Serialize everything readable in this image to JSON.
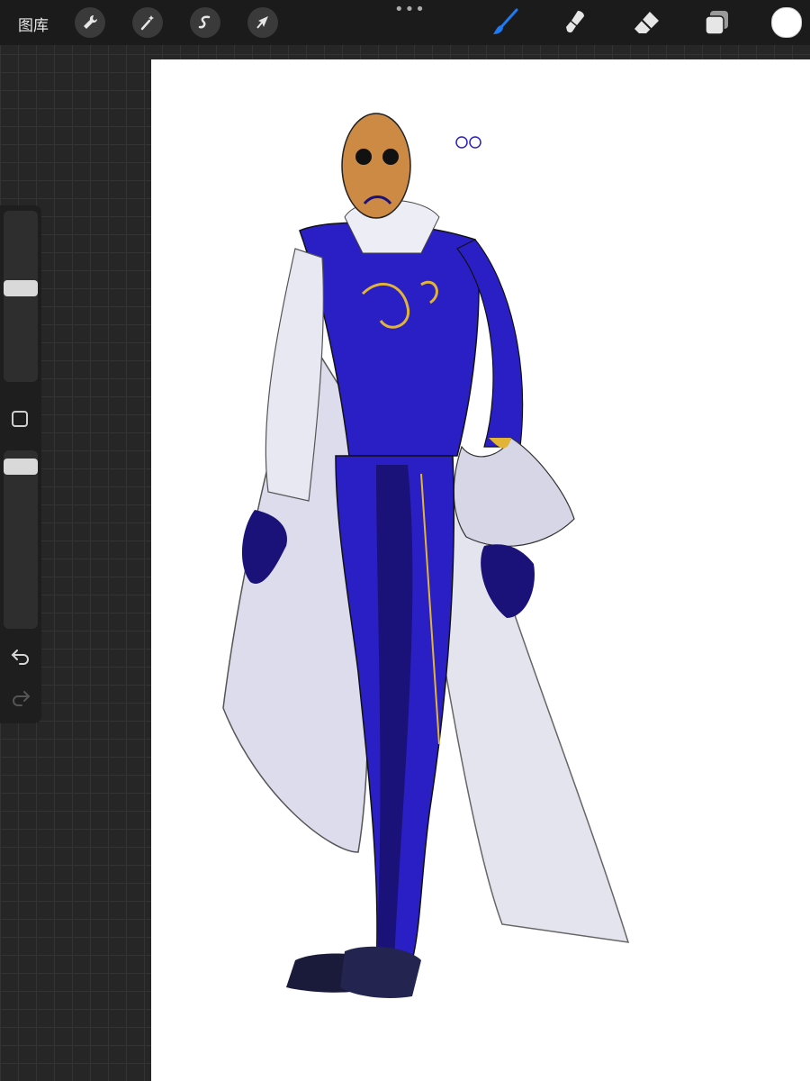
{
  "toolbar": {
    "gallery_label": "图库",
    "left_tools": [
      "wrench-icon",
      "magic-wand-icon",
      "selection-icon",
      "transform-arrow-icon"
    ],
    "more_label": "•••",
    "right_tools": [
      "brush-icon",
      "smudge-icon",
      "eraser-icon",
      "layers-icon"
    ],
    "active_tool": "brush",
    "accent_color": "#1e7bf3",
    "current_color": "#ffffff"
  },
  "sidebar": {
    "brush_size_level": 0.55,
    "opacity_level": 0.95,
    "buttons": [
      "modify-button",
      "undo-arrow-icon",
      "redo-arrow-icon"
    ]
  },
  "canvas": {
    "content": "illustration",
    "palette": {
      "skin": "#cc8a45",
      "robe": "#2a1fc4",
      "robe_dark": "#1a1278",
      "cape": "#dcdcec",
      "gold": "#e2b436"
    }
  }
}
